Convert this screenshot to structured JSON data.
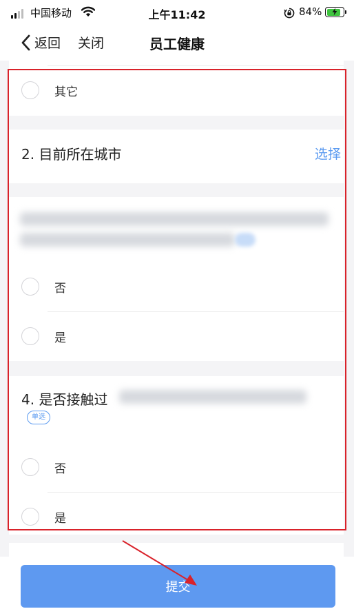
{
  "status_bar": {
    "carrier": "中国移动",
    "time": "上午11:42",
    "battery": "84%",
    "icons": [
      "signal-icon",
      "wifi-icon",
      "rotation-lock-icon",
      "battery-charging-icon"
    ]
  },
  "nav": {
    "back_label": "返回",
    "close_label": "关闭",
    "title": "员工健康"
  },
  "form": {
    "q1_last_option": "其它",
    "q2": {
      "title": "2. 目前所在城市",
      "action": "选择"
    },
    "q3": {
      "options": [
        "否",
        "是"
      ]
    },
    "q4": {
      "title": "4. 是否接触过",
      "badge": "单选",
      "options": [
        "否",
        "是"
      ]
    }
  },
  "footer": {
    "submit_label": "提交"
  },
  "colors": {
    "accent": "#5b9af0",
    "submit": "#5e99f0",
    "highlight": "#d9222a",
    "background": "#f4f4f6"
  }
}
